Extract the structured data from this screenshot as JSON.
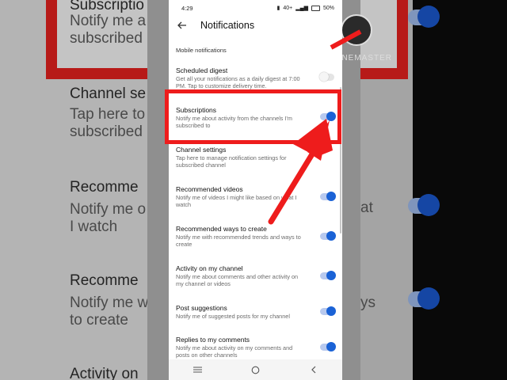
{
  "background": {
    "left_texts": [
      "Subscriptio",
      "Notify me a",
      "subscribed",
      "Channel se",
      "Tap here to",
      "subscribed",
      "Recomme",
      "Notify me o",
      "I watch",
      "Recomme",
      "Notify me w",
      "to create",
      "Activity on"
    ],
    "right_texts": [
      "at",
      "ys"
    ],
    "watermark": "KINEMASTER"
  },
  "status_bar": {
    "time": "4:29",
    "network": "40+",
    "battery": "50%"
  },
  "header": {
    "back_icon": "arrow-left-icon",
    "title": "Notifications"
  },
  "section_title": "Mobile notifications",
  "settings": [
    {
      "title": "Scheduled digest",
      "desc": "Get all your notifications as a daily digest at 7:00 PM. Tap to customize delivery time.",
      "on": false
    },
    {
      "title": "Subscriptions",
      "desc": "Notify me about activity from the channels I'm subscribed to",
      "on": true
    },
    {
      "title": "Channel settings",
      "desc": "Tap here to manage notification settings for subscribed channel",
      "on": null
    },
    {
      "title": "Recommended videos",
      "desc": "Notify me of videos I might like based on what I watch",
      "on": true
    },
    {
      "title": "Recommended ways to create",
      "desc": "Notify me with recommended trends and ways to create",
      "on": true
    },
    {
      "title": "Activity on my channel",
      "desc": "Notify me about comments and other activity on my channel or videos",
      "on": true
    },
    {
      "title": "Post suggestions",
      "desc": "Notify me of suggested posts for my channel",
      "on": true
    },
    {
      "title": "Replies to my comments",
      "desc": "Notify me about activity on my comments and posts on other channels",
      "on": true
    }
  ],
  "nav": [
    "menu-icon",
    "home-circle-icon",
    "back-chevron-icon"
  ],
  "colors": {
    "accent": "#1a62d6",
    "highlight": "#ee1c1c"
  }
}
